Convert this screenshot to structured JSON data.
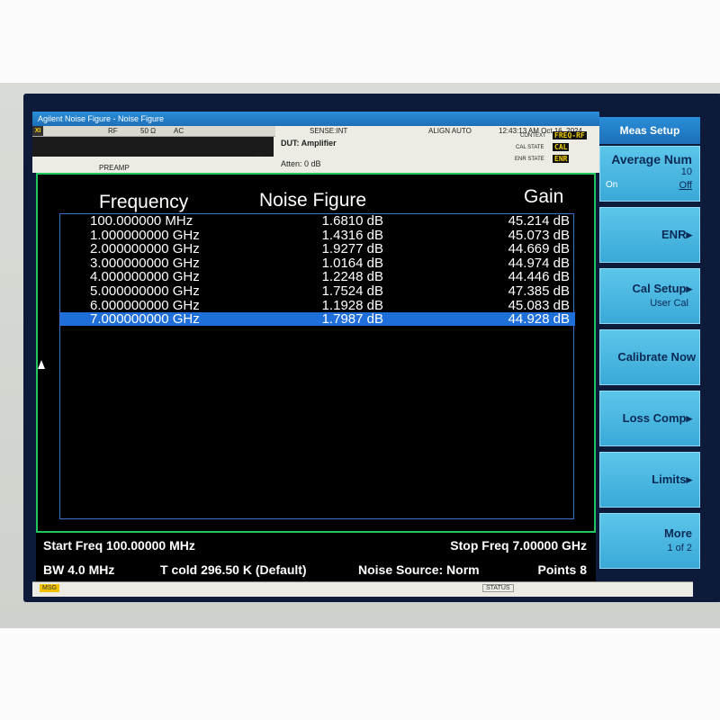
{
  "window": {
    "title": "Agilent Noise Figure - Noise Figure"
  },
  "infobar": {
    "rf": "RF",
    "impedance": "50 Ω",
    "coupling": "AC",
    "sense": "SENSE:INT",
    "align": "ALIGN AUTO",
    "datetime": "12:43:13 AM Oct 16, 2024",
    "dut": "DUT: Amplifier",
    "atten": "Atten: 0 dB",
    "preamp": "PREAMP",
    "context_label": "CONTEXT",
    "context_value": "FREQ-RF",
    "cal_state_label": "CAL STATE",
    "cal_state_value": "CAL",
    "enr_state_label": "ENR STATE",
    "enr_state_value": "ENR"
  },
  "table": {
    "headers": {
      "frequency": "Frequency",
      "noise_figure": "Noise Figure",
      "gain": "Gain"
    },
    "rows": [
      {
        "frequency": "100.000000 MHz",
        "noise_figure": "1.6810 dB",
        "gain": "45.214 dB"
      },
      {
        "frequency": "1.000000000 GHz",
        "noise_figure": "1.4316 dB",
        "gain": "45.073 dB"
      },
      {
        "frequency": "2.000000000 GHz",
        "noise_figure": "1.9277 dB",
        "gain": "44.669 dB"
      },
      {
        "frequency": "3.000000000 GHz",
        "noise_figure": "1.0164 dB",
        "gain": "44.974 dB"
      },
      {
        "frequency": "4.000000000 GHz",
        "noise_figure": "1.2248 dB",
        "gain": "44.446 dB"
      },
      {
        "frequency": "5.000000000 GHz",
        "noise_figure": "1.7524 dB",
        "gain": "47.385 dB"
      },
      {
        "frequency": "6.000000000 GHz",
        "noise_figure": "1.1928 dB",
        "gain": "45.083 dB"
      },
      {
        "frequency": "7.000000000 GHz",
        "noise_figure": "1.7987 dB",
        "gain": "44.928 dB"
      }
    ],
    "selected_row": 8
  },
  "readout": {
    "start_freq": "Start Freq 100.00000 MHz",
    "stop_freq": "Stop Freq 7.00000 GHz",
    "bw": "BW 4.0 MHz",
    "t_cold": "T cold 296.50 K (Default)",
    "noise_source": "Noise Source: Norm",
    "points": "Points 8"
  },
  "msgbar": {
    "msg": "MSG",
    "status": "STATUS"
  },
  "softkeys": {
    "title": "Meas Setup",
    "average_num": {
      "label": "Average Num",
      "value": "10",
      "on": "On",
      "off": "Off"
    },
    "enr": "ENR",
    "cal_setup": {
      "label": "Cal Setup",
      "sub": "User Cal"
    },
    "calibrate_now": "Calibrate Now",
    "loss_comp": "Loss Comp",
    "limits": "Limits",
    "more": {
      "label": "More",
      "sub": "1 of 2"
    }
  },
  "colors": {
    "selection": "#1e6fd9",
    "softkey": "#4fb8e2",
    "border_green": "#22c55e",
    "title_blue": "#1d6fb8"
  }
}
